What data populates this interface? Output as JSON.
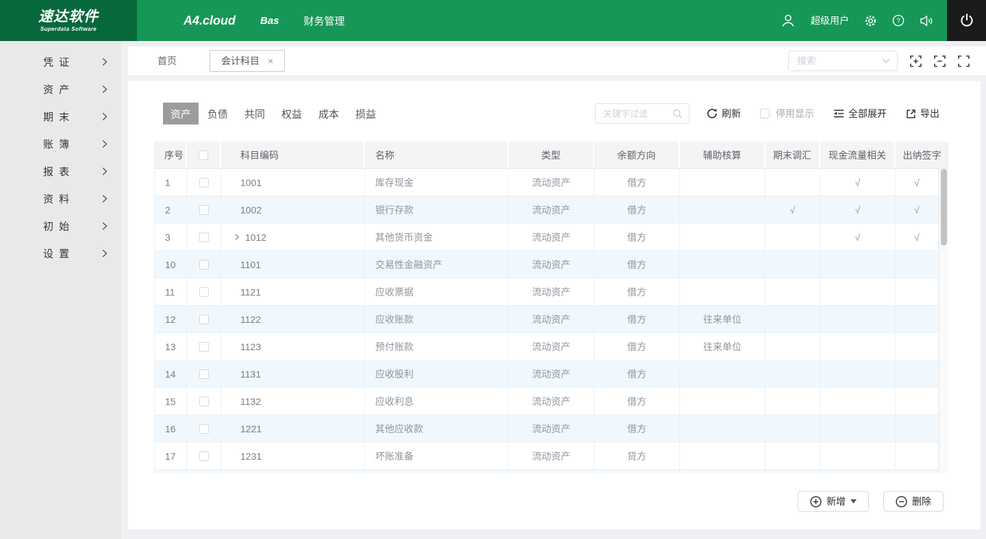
{
  "colors": {
    "brand_dark_green": "#07693B",
    "brand_green": "#179757",
    "power_section_bg": "#1B1B1B",
    "active_category_bg": "#9C9C9C",
    "alt_row_bg": "#F1F8FD"
  },
  "header": {
    "logo_title": "速达软件",
    "logo_subtitle": "Superdata Software",
    "nav_items": [
      "A4.cloud",
      "Bas",
      "财务管理"
    ],
    "user_name": "超级用户"
  },
  "sidebar": {
    "items": [
      {
        "label": "凭 证"
      },
      {
        "label": "资 产"
      },
      {
        "label": "期 末"
      },
      {
        "label": "账 簿"
      },
      {
        "label": "报 表"
      },
      {
        "label": "资 料"
      },
      {
        "label": "初 始"
      },
      {
        "label": "设 置"
      }
    ]
  },
  "tabbar": {
    "home_label": "首页",
    "active_tab_label": "会计科目",
    "close_glyph": "×",
    "search_placeholder": "搜索"
  },
  "toolbar": {
    "categories": [
      "资产",
      "负债",
      "共同",
      "权益",
      "成本",
      "损益"
    ],
    "active_category": "资产",
    "filter_placeholder": "关键字过滤",
    "refresh_label": "刷新",
    "stop_display_label": "停用显示",
    "expand_all_label": "全部展开",
    "export_label": "导出"
  },
  "table": {
    "columns": {
      "seq": "序号",
      "code": "科目编码",
      "name": "名称",
      "type": "类型",
      "direction": "余额方向",
      "aux": "辅助核算",
      "fx": "期末调汇",
      "cashflow": "现金流量相关",
      "cashier": "出纳签字"
    },
    "rows": [
      {
        "seq": "1",
        "code": "1001",
        "expandable": false,
        "name": "库存现金",
        "type": "流动资产",
        "direction": "借方",
        "aux": "",
        "fx": "",
        "cashflow": "√",
        "cashier": "√"
      },
      {
        "seq": "2",
        "code": "1002",
        "expandable": false,
        "name": "银行存款",
        "type": "流动资产",
        "direction": "借方",
        "aux": "",
        "fx": "√",
        "cashflow": "√",
        "cashier": "√"
      },
      {
        "seq": "3",
        "code": "1012",
        "expandable": true,
        "name": "其他货币资金",
        "type": "流动资产",
        "direction": "借方",
        "aux": "",
        "fx": "",
        "cashflow": "√",
        "cashier": "√"
      },
      {
        "seq": "10",
        "code": "1101",
        "expandable": false,
        "name": "交易性金融资产",
        "type": "流动资产",
        "direction": "借方",
        "aux": "",
        "fx": "",
        "cashflow": "",
        "cashier": ""
      },
      {
        "seq": "11",
        "code": "1121",
        "expandable": false,
        "name": "应收票据",
        "type": "流动资产",
        "direction": "借方",
        "aux": "",
        "fx": "",
        "cashflow": "",
        "cashier": ""
      },
      {
        "seq": "12",
        "code": "1122",
        "expandable": false,
        "name": "应收账款",
        "type": "流动资产",
        "direction": "借方",
        "aux": "往来单位",
        "fx": "",
        "cashflow": "",
        "cashier": ""
      },
      {
        "seq": "13",
        "code": "1123",
        "expandable": false,
        "name": "预付账款",
        "type": "流动资产",
        "direction": "借方",
        "aux": "往来单位",
        "fx": "",
        "cashflow": "",
        "cashier": ""
      },
      {
        "seq": "14",
        "code": "1131",
        "expandable": false,
        "name": "应收股利",
        "type": "流动资产",
        "direction": "借方",
        "aux": "",
        "fx": "",
        "cashflow": "",
        "cashier": ""
      },
      {
        "seq": "15",
        "code": "1132",
        "expandable": false,
        "name": "应收利息",
        "type": "流动资产",
        "direction": "借方",
        "aux": "",
        "fx": "",
        "cashflow": "",
        "cashier": ""
      },
      {
        "seq": "16",
        "code": "1221",
        "expandable": false,
        "name": "其他应收款",
        "type": "流动资产",
        "direction": "借方",
        "aux": "",
        "fx": "",
        "cashflow": "",
        "cashier": ""
      },
      {
        "seq": "17",
        "code": "1231",
        "expandable": false,
        "name": "坏账准备",
        "type": "流动资产",
        "direction": "贷方",
        "aux": "",
        "fx": "",
        "cashflow": "",
        "cashier": ""
      }
    ]
  },
  "footer": {
    "add_label": "新增",
    "delete_label": "删除"
  }
}
